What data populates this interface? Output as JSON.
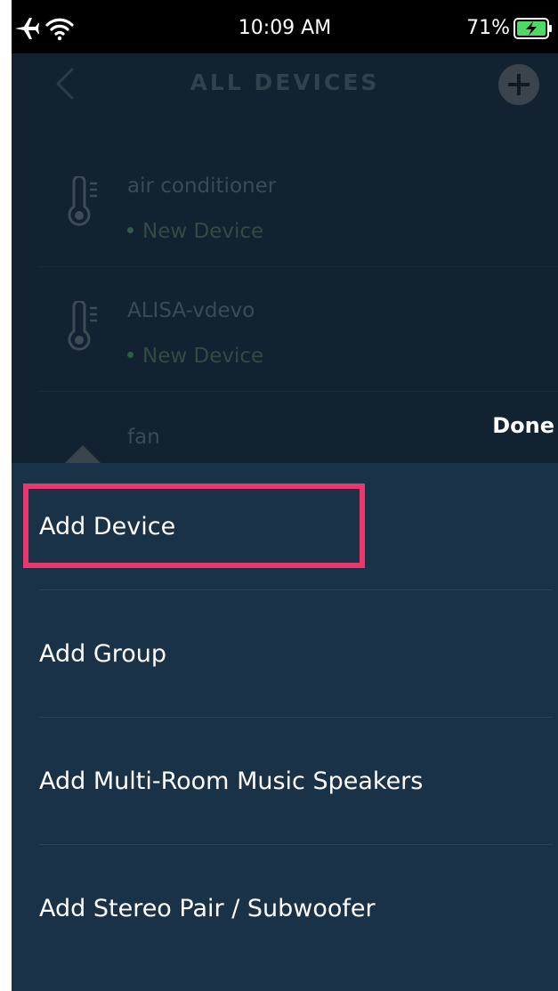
{
  "status_bar": {
    "time": "10:09 AM",
    "battery": "71%"
  },
  "header": {
    "title": "ALL DEVICES"
  },
  "devices": [
    {
      "name": "air conditioner",
      "status": "New Device",
      "icon": "thermometer-icon"
    },
    {
      "name": "ALISA-vdevo",
      "status": "New Device",
      "icon": "thermometer-icon"
    },
    {
      "name": "fan",
      "icon": "fan-icon"
    }
  ],
  "done_label": "Done",
  "sheet": {
    "items": [
      {
        "label": "Add Device",
        "highlighted": true
      },
      {
        "label": "Add Group"
      },
      {
        "label": "Add Multi-Room Music Speakers"
      },
      {
        "label": "Add Stereo Pair / Subwoofer"
      }
    ]
  },
  "colors": {
    "highlight": "#e8386d",
    "sheet_bg": "#1a3248",
    "dim_bg": "#122230",
    "battery_green": "#4cd964"
  }
}
